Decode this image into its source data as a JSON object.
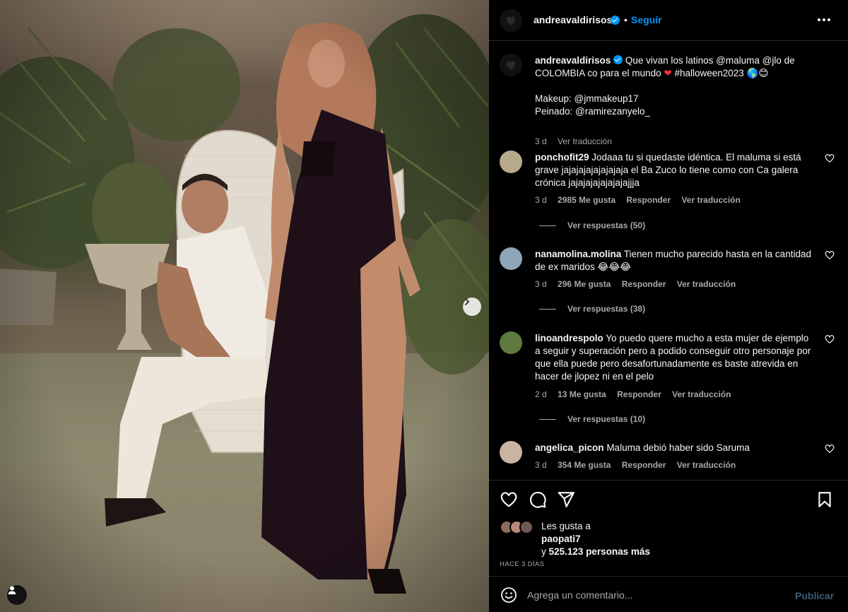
{
  "post": {
    "username": "andreavaldirisos",
    "follow_label": "Seguir",
    "dot": "•"
  },
  "caption": {
    "username": "andreavaldirisos",
    "text_line1": "Que vivan los latinos @maluma @jlo de COLOMBIA co para el mundo",
    "heart": "❤",
    "hashtag": "#halloween2023",
    "emojis": "🌎😊",
    "makeup": "Makeup: @jmmakeup17",
    "hair": "Peinado: @ramirezanyelo_",
    "time": "3 d",
    "translate_label": "Ver traducción"
  },
  "comments": [
    {
      "username": "ponchofit29",
      "text": "Jodaaa tu si quedaste idéntica. El maluma si está grave jajajajajajajajaja el Ba Zuco lo tiene como con Ca galera crónica jajajajajajajajajjja",
      "time": "3 d",
      "likes": "2985 Me gusta",
      "reply_label": "Responder",
      "translate_label": "Ver traducción",
      "replies": "Ver respuestas (50)",
      "avatar_color": "#b7a98c"
    },
    {
      "username": "nanamolina.molina",
      "text": "Tienen mucho parecido hasta en la cantidad de ex maridos 😂😂😂",
      "time": "3 d",
      "likes": "296 Me gusta",
      "reply_label": "Responder",
      "translate_label": "Ver traducción",
      "replies": "Ver respuestas (38)",
      "avatar_color": "#8fa6b8"
    },
    {
      "username": "linoandrespolo",
      "text": "Yo puedo quere mucho a esta mujer de ejemplo a seguir y superación pero a podido conseguir otro personaje por que ella puede pero desafortunadamente es baste atrevida en hacer de jlopez ni en el pelo",
      "time": "2 d",
      "likes": "13 Me gusta",
      "reply_label": "Responder",
      "translate_label": "Ver traducción",
      "replies": "Ver respuestas (10)",
      "avatar_color": "#5f7a3e"
    },
    {
      "username": "angelica_picon",
      "text": "Maluma debió haber sido Saruma",
      "time": "3 d",
      "likes": "354 Me gusta",
      "reply_label": "Responder",
      "translate_label": "Ver traducción",
      "replies": "",
      "avatar_color": "#c9b3a2"
    }
  ],
  "likes": {
    "prefix": "Les gusta a",
    "user": "paopati7",
    "suffix_prefix": "y",
    "others": "525.123 personas más"
  },
  "time_ago": "HACE 3 DÍAS",
  "composer": {
    "placeholder": "Agrega un comentario...",
    "publish_label": "Publicar"
  },
  "colors": {
    "accent": "#0095f6",
    "muted": "#a8a8a8",
    "background": "#000000"
  },
  "icons": [
    "more-options-icon",
    "verified-badge-icon",
    "heart-icon",
    "comment-icon",
    "share-icon",
    "bookmark-icon",
    "emoji-icon",
    "next-arrow-icon",
    "tagged-user-icon"
  ]
}
